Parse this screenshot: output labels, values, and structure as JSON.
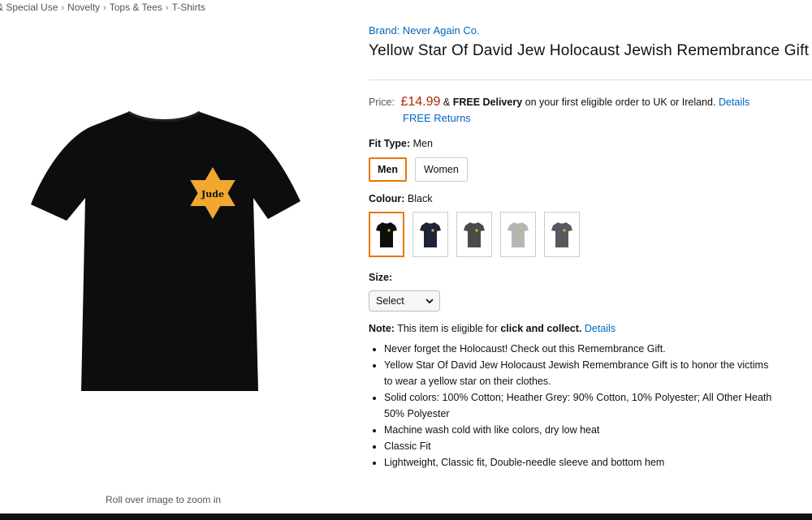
{
  "breadcrumb": {
    "items": [
      "& Special Use",
      "Novelty",
      "Tops & Tees",
      "T-Shirts"
    ],
    "separator": "›"
  },
  "image": {
    "zoom_hint": "Roll over image to zoom in",
    "shirt_color": "#0d0d0d",
    "star_color": "#f0a830",
    "star_text": "Jude"
  },
  "product": {
    "brand": "Brand: Never Again Co.",
    "title": "Yellow Star Of David Jew Holocaust Jewish Remembrance Gift",
    "price_label": "Price:",
    "price": "£14.99",
    "delivery_prefix": "&",
    "delivery_bold": "FREE Delivery",
    "delivery_text": "on your first eligible order to UK or Ireland.",
    "details_link": "Details",
    "returns_link": "FREE Returns"
  },
  "fit_type": {
    "label": "Fit Type:",
    "value": "Men",
    "options": [
      "Men",
      "Women"
    ],
    "selected": "Men"
  },
  "colour": {
    "label": "Colour:",
    "value": "Black",
    "options": [
      {
        "name": "Black",
        "hex": "#0d0d0d"
      },
      {
        "name": "Navy",
        "hex": "#1c2435"
      },
      {
        "name": "Dark Heather",
        "hex": "#4a4a4a"
      },
      {
        "name": "Heather Grey",
        "hex": "#b5b5b5"
      },
      {
        "name": "Asphalt",
        "hex": "#555a60"
      }
    ]
  },
  "size": {
    "label": "Size:",
    "value": "Select"
  },
  "note": {
    "prefix": "Note:",
    "text": "This item is eligible for",
    "bold": "click and collect.",
    "link": "Details"
  },
  "bullets": [
    "Never forget the Holocaust! Check out this Remembrance Gift.",
    "Yellow Star Of David Jew Holocaust Jewish Remembrance Gift is to honor the victims",
    "to wear a yellow star on their clothes.",
    "Solid colors: 100% Cotton; Heather Grey: 90% Cotton, 10% Polyester; All Other Heath",
    "50% Polyester",
    "Machine wash cold with like colors, dry low heat",
    "Classic Fit",
    "Lightweight, Classic fit, Double-needle sleeve and bottom hem"
  ]
}
